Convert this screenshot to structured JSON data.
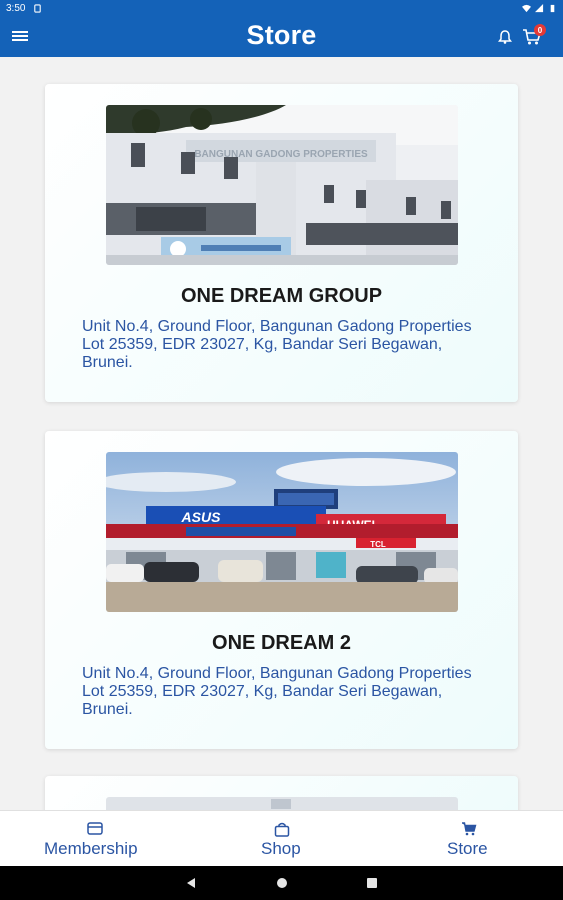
{
  "status_bar": {
    "time": "3:50"
  },
  "app_bar": {
    "title": "Store",
    "cart_count": "0"
  },
  "stores": [
    {
      "name": "ONE DREAM GROUP",
      "address_line1": "Unit No.4, Ground Floor, Bangunan Gadong Properties",
      "address_line2": "Lot 25359, EDR 23027, Kg, Bandar Seri Begawan, Brunei."
    },
    {
      "name": "ONE DREAM 2",
      "address_line1": "Unit No.4, Ground Floor, Bangunan Gadong Properties",
      "address_line2": "Lot 25359, EDR 23027, Kg, Bandar Seri Begawan, Brunei."
    }
  ],
  "store1_sign": "BANGUNAN GADONG PROPERTIES",
  "store2_signs": {
    "left": "ASUS",
    "right": "HUAWEI",
    "tcl": "TCL"
  },
  "bottom_nav": {
    "membership": "Membership",
    "shop": "Shop",
    "store": "Store"
  },
  "colors": {
    "primary": "#1462b8",
    "link": "#2b55a3",
    "badge": "#e53935"
  }
}
